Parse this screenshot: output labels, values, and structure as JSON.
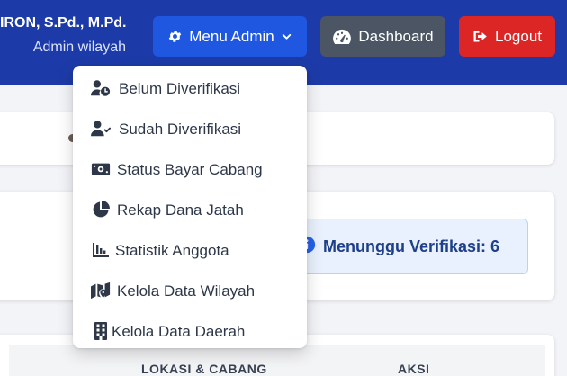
{
  "header": {
    "user_name": "IRON, S.Pd., M.Pd.",
    "user_role": "Admin wilayah",
    "menu_admin_label": "Menu Admin",
    "dashboard_label": "Dashboard",
    "logout_label": "Logout"
  },
  "menu": {
    "items": [
      {
        "label": "Belum Diverifikasi",
        "icon": "user-clock-icon"
      },
      {
        "label": "Sudah Diverifikasi",
        "icon": "user-check-icon"
      },
      {
        "label": "Status Bayar Cabang",
        "icon": "money-bill-icon"
      },
      {
        "label": "Rekap Dana Jatah",
        "icon": "pie-chart-icon"
      },
      {
        "label": "Statistik Anggota",
        "icon": "bar-chart-icon"
      },
      {
        "label": "Kelola Data Wilayah",
        "icon": "map-marker-icon"
      },
      {
        "label": "Kelola Data Daerah",
        "icon": "building-icon"
      }
    ]
  },
  "summary": {
    "pending_label": "Menunggu Verifikasi: 6"
  },
  "table": {
    "columns": [
      "LOKASI & CABANG",
      "AKSI"
    ]
  },
  "colors": {
    "header_bg": "#1d3ba8",
    "menu_button": "#1f57e0",
    "dashboard_button": "#4b5563",
    "logout_button": "#dc2626",
    "menu_text": "#2d3748",
    "pending_text": "#1e3f8a"
  }
}
